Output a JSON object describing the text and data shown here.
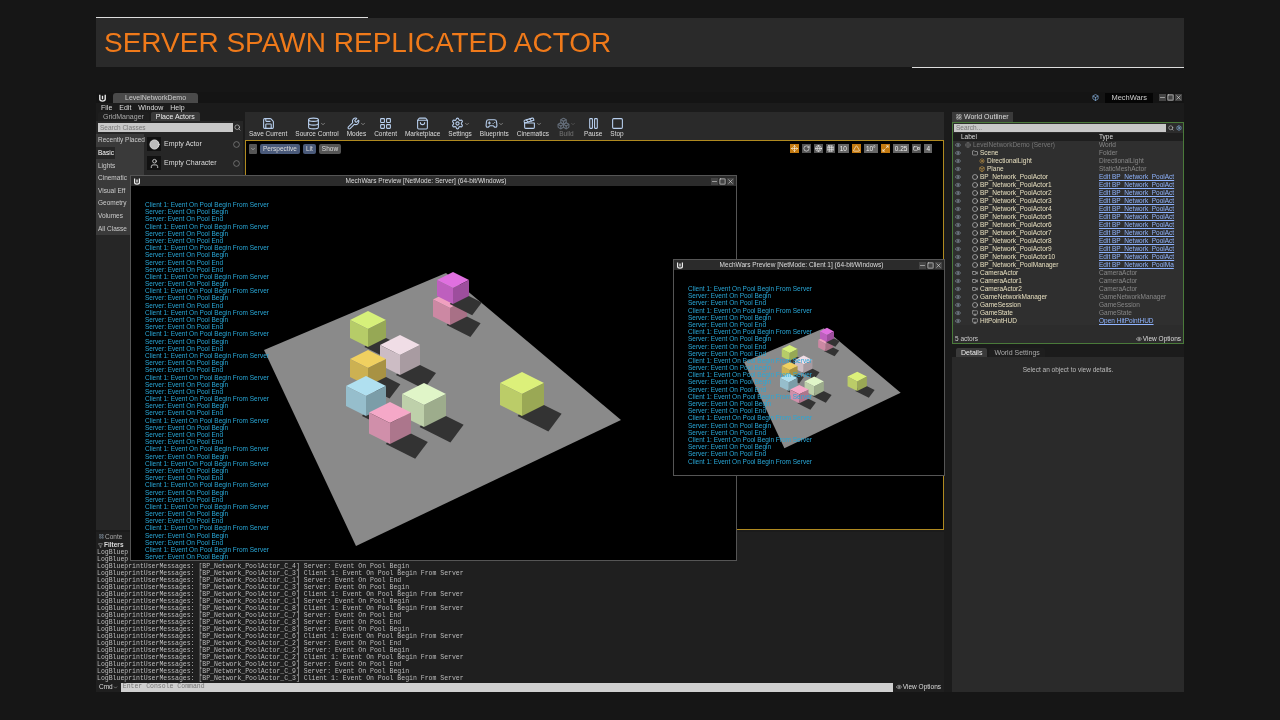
{
  "slide": {
    "title": "SERVER SPAWN REPLICATED ACTOR"
  },
  "editor": {
    "document_tab": "LevelNetworkDemo",
    "project": "MechWars",
    "menu": [
      "File",
      "Edit",
      "Window",
      "Help"
    ],
    "left_panel": {
      "tabs": [
        {
          "label": "GridManager",
          "selected": false
        },
        {
          "label": "Place Actors",
          "selected": true
        }
      ],
      "search_placeholder": "Search Classes",
      "categories": [
        {
          "label": "Recently Placed",
          "selected": false
        },
        {
          "label": "Basic",
          "selected": true
        },
        {
          "label": "Lights",
          "selected": false
        },
        {
          "label": "Cinematic",
          "selected": false
        },
        {
          "label": "Visual Eff",
          "selected": false
        },
        {
          "label": "Geometry",
          "selected": false
        },
        {
          "label": "Volumes",
          "selected": false
        },
        {
          "label": "All Classe",
          "selected": false
        }
      ],
      "items": [
        {
          "label": "Empty Actor",
          "kind": "actor"
        },
        {
          "label": "Empty Character",
          "kind": "character"
        }
      ]
    },
    "toolbar": [
      {
        "label": "Save Current",
        "kind": "save",
        "dropdown": false,
        "disabled": false
      },
      {
        "label": "Source Control",
        "kind": "source",
        "dropdown": true,
        "disabled": false
      },
      {
        "label": "Modes",
        "kind": "modes",
        "dropdown": true,
        "disabled": false
      },
      {
        "label": "Content",
        "kind": "content",
        "dropdown": false,
        "disabled": false
      },
      {
        "label": "Marketplace",
        "kind": "market",
        "dropdown": false,
        "disabled": false
      },
      {
        "label": "Settings",
        "kind": "settings",
        "dropdown": true,
        "disabled": false
      },
      {
        "label": "Blueprints",
        "kind": "blueprints",
        "dropdown": true,
        "disabled": false
      },
      {
        "label": "Cinematics",
        "kind": "cinematics",
        "dropdown": true,
        "disabled": false
      },
      {
        "label": "Build",
        "kind": "build",
        "dropdown": true,
        "disabled": true
      },
      {
        "label": "Pause",
        "kind": "pause",
        "dropdown": false,
        "disabled": false
      },
      {
        "label": "Stop",
        "kind": "stop",
        "dropdown": false,
        "disabled": false
      }
    ],
    "viewport": {
      "buttons": [
        {
          "label": "Perspective",
          "kind": "perspective"
        },
        {
          "label": "Lit",
          "kind": "lit"
        },
        {
          "label": "Show",
          "kind": "show"
        }
      ],
      "grid_snap": "10",
      "rotation_snap": "10°",
      "scale_snap": "0.25",
      "camera_speed": "4"
    },
    "preview_windows": [
      {
        "title": "MechWars Preview [NetMode: Server] (64-bit/Windows)",
        "messages": [
          "Client 1: Event On Pool Begin From Server",
          "Server: Event On Pool Begin",
          "Server: Event On Pool End",
          "Client 1: Event On Pool Begin From Server",
          "Server: Event On Pool Begin",
          "Server: Event On Pool End",
          "Client 1: Event On Pool Begin From Server",
          "Server: Event On Pool Begin",
          "Server: Event On Pool End",
          "Server: Event On Pool End",
          "Client 1: Event On Pool Begin From Server",
          "Server: Event On Pool Begin",
          "Client 1: Event On Pool Begin From Server",
          "Server: Event On Pool Begin",
          "Server: Event On Pool End",
          "Client 1: Event On Pool Begin From Server",
          "Server: Event On Pool Begin",
          "Server: Event On Pool End",
          "Client 1: Event On Pool Begin From Server",
          "Server: Event On Pool Begin",
          "Server: Event On Pool End",
          "Client 1: Event On Pool Begin From Server",
          "Server: Event On Pool Begin",
          "Server: Event On Pool End",
          "Client 1: Event On Pool Begin From Server",
          "Server: Event On Pool Begin",
          "Server: Event On Pool End",
          "Client 1: Event On Pool Begin From Server",
          "Server: Event On Pool Begin",
          "Server: Event On Pool End",
          "Client 1: Event On Pool Begin From Server",
          "Server: Event On Pool Begin",
          "Server: Event On Pool End",
          "Server: Event On Pool End",
          "Client 1: Event On Pool Begin From Server",
          "Server: Event On Pool Begin",
          "Client 1: Event On Pool Begin From Server",
          "Server: Event On Pool Begin",
          "Server: Event On Pool End",
          "Client 1: Event On Pool Begin From Server",
          "Server: Event On Pool Begin",
          "Server: Event On Pool End",
          "Client 1: Event On Pool Begin From Server",
          "Server: Event On Pool Begin",
          "Server: Event On Pool End",
          "Client 1: Event On Pool Begin From Server",
          "Server: Event On Pool Begin",
          "Server: Event On Pool End",
          "Client 1: Event On Pool Begin From Server",
          "Server: Event On Pool Begin"
        ]
      },
      {
        "title": "MechWars Preview [NetMode: Client 1] (64-bit/Windows)",
        "messages": [
          "Client 1: Event On Pool Begin From Server",
          "Server: Event On Pool Begin",
          "Server: Event On Pool End",
          "Client 1: Event On Pool Begin From Server",
          "Server: Event On Pool Begin",
          "Server: Event On Pool End",
          "Client 1: Event On Pool Begin From Server",
          "Server: Event On Pool Begin",
          "Server: Event On Pool End",
          "Server: Event On Pool End",
          "Client 1: Event On Pool Begin From Server",
          "Server: Event On Pool Begin",
          "Client 1: Event On Pool Begin From Server",
          "Server: Event On Pool Begin",
          "Server: Event On Pool End",
          "Client 1: Event On Pool Begin From Server",
          "Server: Event On Pool Begin",
          "Server: Event On Pool End",
          "Client 1: Event On Pool Begin From Server",
          "Server: Event On Pool Begin",
          "Server: Event On Pool End",
          "Client 1: Event On Pool Begin From Server",
          "Server: Event On Pool Begin",
          "Server: Event On Pool End",
          "Client 1: Event On Pool Begin From Server"
        ]
      }
    ],
    "world_outliner": {
      "tab": "World Outliner",
      "search_placeholder": "Search...",
      "columns": [
        "Label",
        "Type"
      ],
      "rows": [
        {
          "label": "LevelNetworkDemo (Server)",
          "type": "World",
          "kind": "world",
          "link": false,
          "children": [
            {
              "label": "Scene",
              "type": "Folder",
              "kind": "folder",
              "link": false,
              "children": [
                {
                  "label": "DirectionalLight",
                  "type": "DirectionalLight",
                  "kind": "light",
                  "link": false
                },
                {
                  "label": "Plane",
                  "type": "StaticMeshActor",
                  "kind": "mesh",
                  "link": false
                }
              ]
            },
            {
              "label": "BP_Network_PoolActor",
              "type": "Edit BP_Network_PoolAct",
              "kind": "blueprint",
              "link": true
            },
            {
              "label": "BP_Network_PoolActor1",
              "type": "Edit BP_Network_PoolAct",
              "kind": "blueprint",
              "link": true
            },
            {
              "label": "BP_Network_PoolActor2",
              "type": "Edit BP_Network_PoolAct",
              "kind": "blueprint",
              "link": true
            },
            {
              "label": "BP_Network_PoolActor3",
              "type": "Edit BP_Network_PoolAct",
              "kind": "blueprint",
              "link": true
            },
            {
              "label": "BP_Network_PoolActor4",
              "type": "Edit BP_Network_PoolAct",
              "kind": "blueprint",
              "link": true
            },
            {
              "label": "BP_Network_PoolActor5",
              "type": "Edit BP_Network_PoolAct",
              "kind": "blueprint",
              "link": true
            },
            {
              "label": "BP_Network_PoolActor6",
              "type": "Edit BP_Network_PoolAct",
              "kind": "blueprint",
              "link": true
            },
            {
              "label": "BP_Network_PoolActor7",
              "type": "Edit BP_Network_PoolAct",
              "kind": "blueprint",
              "link": true
            },
            {
              "label": "BP_Network_PoolActor8",
              "type": "Edit BP_Network_PoolAct",
              "kind": "blueprint",
              "link": true
            },
            {
              "label": "BP_Network_PoolActor9",
              "type": "Edit BP_Network_PoolAct",
              "kind": "blueprint",
              "link": true
            },
            {
              "label": "BP_Network_PoolActor10",
              "type": "Edit BP_Network_PoolAct",
              "kind": "blueprint",
              "link": true
            },
            {
              "label": "BP_Network_PoolManager",
              "type": "Edit BP_Network_PoolMa",
              "kind": "blueprint",
              "link": true
            },
            {
              "label": "CameraActor",
              "type": "CameraActor",
              "kind": "camera",
              "link": false
            },
            {
              "label": "CameraActor1",
              "type": "CameraActor",
              "kind": "camera",
              "link": false
            },
            {
              "label": "CameraActor2",
              "type": "CameraActor",
              "kind": "camera",
              "link": false
            },
            {
              "label": "GameNetworkManager",
              "type": "GameNetworkManager",
              "kind": "blueprint",
              "link": false
            },
            {
              "label": "GameSession",
              "type": "GameSession",
              "kind": "blueprint",
              "link": false
            },
            {
              "label": "GameState",
              "type": "GameState",
              "kind": "state",
              "link": false
            },
            {
              "label": "HitPointHUD",
              "type": "Open HitPointHUD",
              "kind": "state",
              "link": true
            }
          ]
        }
      ],
      "actor_count": "5 actors",
      "view_options": "View Options"
    },
    "details": {
      "tabs": [
        {
          "label": "Details",
          "selected": true
        },
        {
          "label": "World Settings",
          "selected": false
        }
      ],
      "empty_message": "Select an object to view details."
    },
    "output_log": {
      "tab": "Conte",
      "filters": "Filters",
      "hidden_lines": [
        "LogBluep",
        "LogBluep"
      ],
      "lines": [
        "LogBlueprintUserMessages: [BP_Network_PoolActor_C_4] Server: Event On Pool Begin",
        "LogBlueprintUserMessages: [BP_Network_PoolActor_C_3] Client 1: Event On Pool Begin From Server",
        "LogBlueprintUserMessages: [BP_Network_PoolActor_C_1] Server: Event On Pool End",
        "LogBlueprintUserMessages: [BP_Network_PoolActor_C_3] Server: Event On Pool Begin",
        "LogBlueprintUserMessages: [BP_Network_PoolActor_C_0] Client 1: Event On Pool Begin From Server",
        "LogBlueprintUserMessages: [BP_Network_PoolActor_C_1] Server: Event On Pool Begin",
        "LogBlueprintUserMessages: [BP_Network_PoolActor_C_8] Client 1: Event On Pool Begin From Server",
        "LogBlueprintUserMessages: [BP_Network_PoolActor_C_7] Server: Event On Pool End",
        "LogBlueprintUserMessages: [BP_Network_PoolActor_C_8] Server: Event On Pool End",
        "LogBlueprintUserMessages: [BP_Network_PoolActor_C_8] Server: Event On Pool Begin",
        "LogBlueprintUserMessages: [BP_Network_PoolActor_C_6] Client 1: Event On Pool Begin From Server",
        "LogBlueprintUserMessages: [BP_Network_PoolActor_C_2] Server: Event On Pool End",
        "LogBlueprintUserMessages: [BP_Network_PoolActor_C_2] Server: Event On Pool Begin",
        "LogBlueprintUserMessages: [BP_Network_PoolActor_C_2] Client 1: Event On Pool Begin From Server",
        "LogBlueprintUserMessages: [BP_Network_PoolActor_C_9] Server: Event On Pool End",
        "LogBlueprintUserMessages: [BP_Network_PoolActor_C_9] Server: Event On Pool Begin",
        "LogBlueprintUserMessages: [BP_Network_PoolActor_C_3] Client 1: Event On Pool Begin From Server"
      ],
      "cmd": "Cmd",
      "console_placeholder": "Enter Console Command",
      "view_options": "View Options"
    }
  }
}
